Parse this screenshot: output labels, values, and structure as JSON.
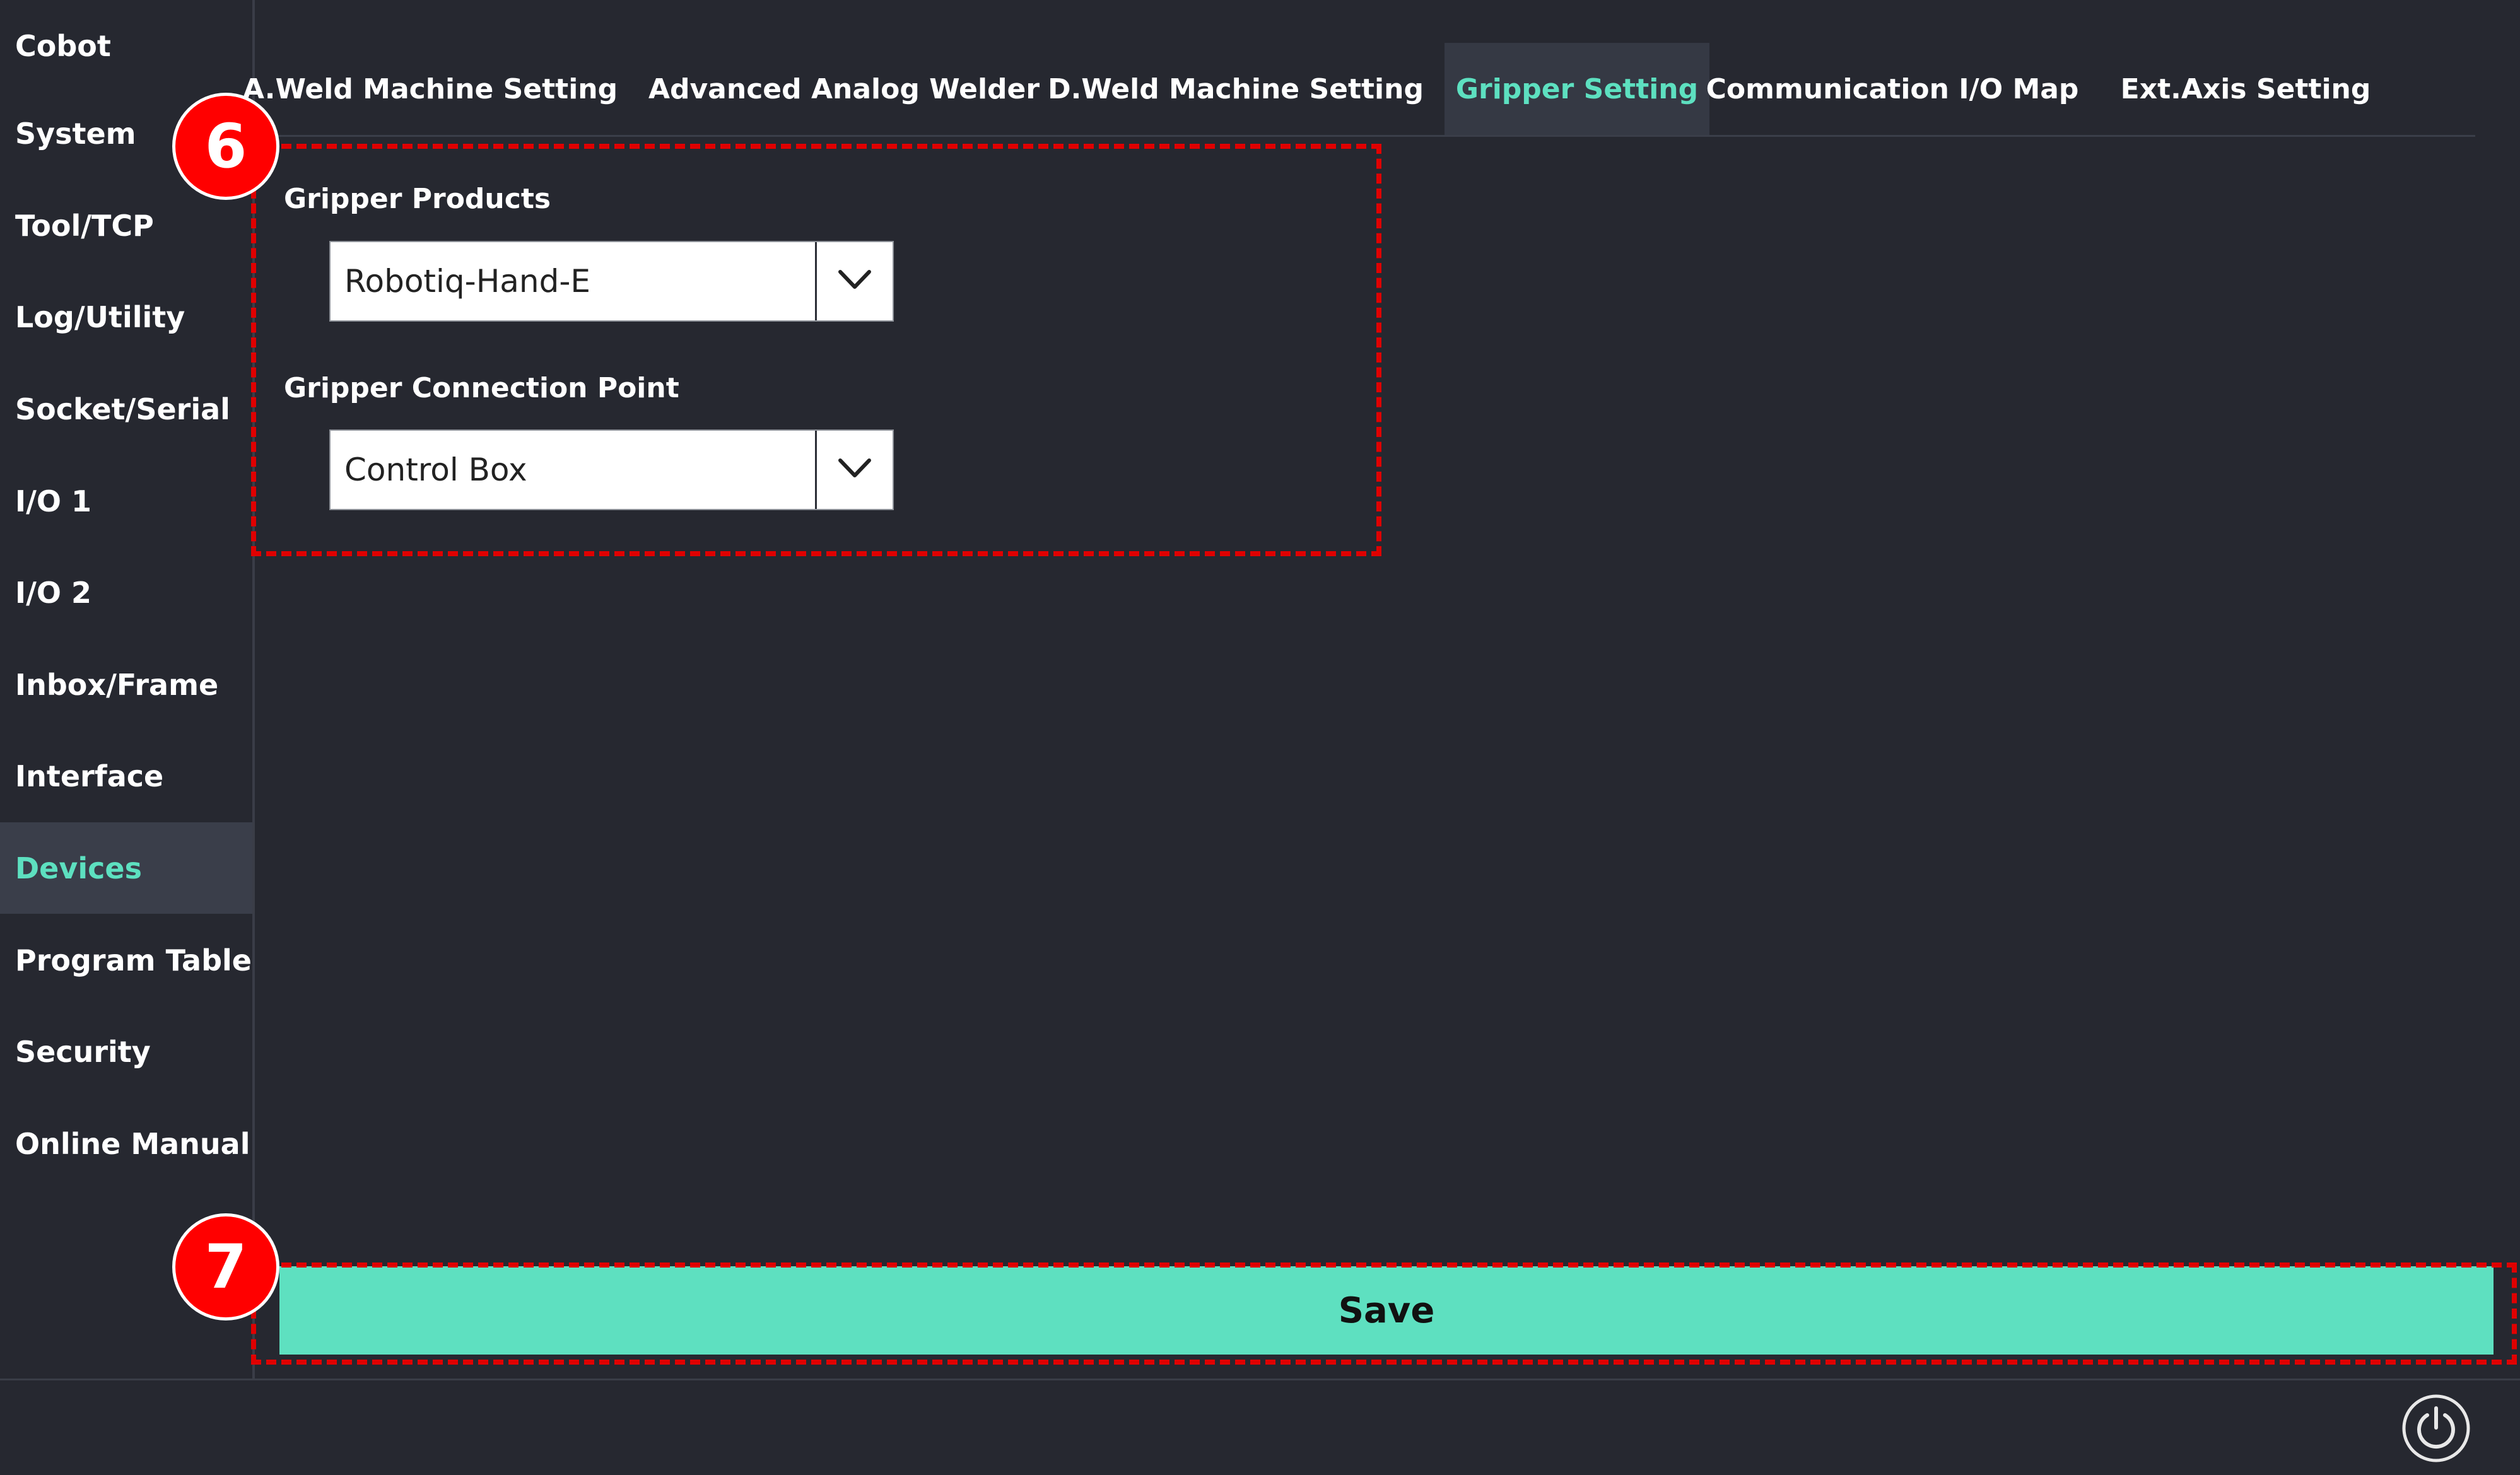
{
  "sidebar": {
    "items": [
      {
        "label": "Cobot"
      },
      {
        "label": "System"
      },
      {
        "label": "Tool/TCP"
      },
      {
        "label": "Log/Utility"
      },
      {
        "label": "Socket/Serial"
      },
      {
        "label": "I/O 1"
      },
      {
        "label": "I/O 2"
      },
      {
        "label": "Inbox/Frame"
      },
      {
        "label": "Interface"
      },
      {
        "label": "Devices",
        "active": true
      },
      {
        "label": "Program Table"
      },
      {
        "label": "Security"
      },
      {
        "label": "Online Manual"
      }
    ]
  },
  "tabs": [
    {
      "label": "A.Weld Machine Setting"
    },
    {
      "label": "Advanced Analog Welder"
    },
    {
      "label": "D.Weld Machine Setting"
    },
    {
      "label": "Gripper Setting",
      "active": true
    },
    {
      "label": "Communication I/O Map"
    },
    {
      "label": "Ext.Axis Setting"
    }
  ],
  "gripper": {
    "products_label": "Gripper Products",
    "products_value": "Robotiq-Hand-E",
    "connection_label": "Gripper Connection Point",
    "connection_value": "Control Box"
  },
  "annotations": {
    "step6": "6",
    "step7": "7"
  },
  "actions": {
    "save_label": "Save"
  },
  "colors": {
    "background": "#262830",
    "accent": "#5de0c0",
    "annotation_red": "#e00000",
    "save_button": "#5ee0c0"
  },
  "icons": {
    "dropdown": "chevron-down-icon",
    "power": "power-icon"
  }
}
